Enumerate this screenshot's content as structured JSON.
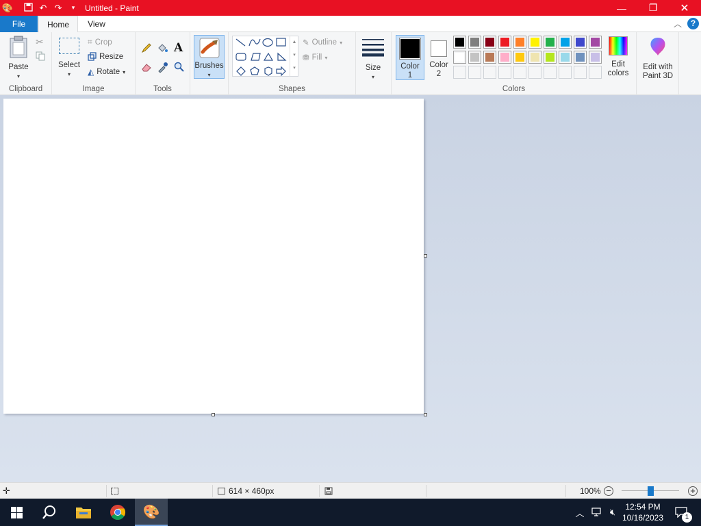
{
  "window": {
    "title": "Untitled - Paint"
  },
  "tabs": {
    "file": "File",
    "home": "Home",
    "view": "View"
  },
  "ribbon": {
    "clipboard": {
      "paste": "Paste",
      "group": "Clipboard"
    },
    "image": {
      "select": "Select",
      "crop": "Crop",
      "resize": "Resize",
      "rotate": "Rotate",
      "group": "Image"
    },
    "tools": {
      "group": "Tools"
    },
    "brushes": {
      "label": "Brushes"
    },
    "shapes": {
      "outline": "Outline",
      "fill": "Fill",
      "group": "Shapes"
    },
    "size": {
      "label": "Size"
    },
    "color1": {
      "line1": "Color",
      "line2": "1",
      "value": "#000000"
    },
    "color2": {
      "line1": "Color",
      "line2": "2",
      "value": "#ffffff"
    },
    "colors": {
      "group": "Colors",
      "row1": [
        "#000000",
        "#7f7f7f",
        "#880015",
        "#ed1c24",
        "#ff7f27",
        "#fff200",
        "#22b14c",
        "#00a2e8",
        "#3f48cc",
        "#a349a4"
      ],
      "row2": [
        "#ffffff",
        "#c3c3c3",
        "#b97a57",
        "#ffaec9",
        "#ffc90e",
        "#efe4b0",
        "#b5e61d",
        "#99d9ea",
        "#7092be",
        "#c8bfe7"
      ],
      "row3_empty": 10,
      "edit_line1": "Edit",
      "edit_line2": "colors"
    },
    "paint3d": {
      "line1": "Edit with",
      "line2": "Paint 3D"
    }
  },
  "status": {
    "dimensions": "614 × 460px",
    "zoom": "100%",
    "zoom_level": 100
  },
  "taskbar": {
    "time": "12:54 PM",
    "date": "10/16/2023",
    "notifications": "1"
  }
}
